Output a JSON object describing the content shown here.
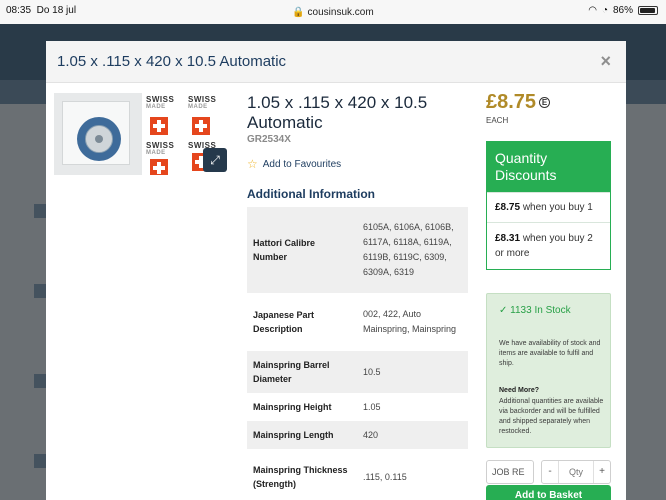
{
  "status_bar": {
    "time": "08:35",
    "date": "Do 18 jul",
    "url": "cousinsuk.com",
    "battery": "86%"
  },
  "modal": {
    "title": "1.05 x .115 x 420 x 10.5 Automatic",
    "close_label": "×"
  },
  "product": {
    "title": "1.05 x .115 x 420 x 10.5 Automatic",
    "sku": "GR2534X",
    "favourites_label": "Add to Favourites",
    "image_text": [
      "SWISS",
      "MADE"
    ]
  },
  "additional_information": {
    "heading": "Additional Information",
    "rows": [
      {
        "label": "Hattori Calibre Number",
        "value": "6105A, 6106A, 6106B, 6117A, 6118A, 6119A, 6119B, 6119C, 6309, 6309A, 6319"
      },
      {
        "label": "Japanese Part Description",
        "value": "002, 422, Auto Mainspring, Mainspring"
      },
      {
        "label": "Mainspring Barrel Diameter",
        "value": "10.5"
      },
      {
        "label": "Mainspring Height",
        "value": "1.05"
      },
      {
        "label": "Mainspring Length",
        "value": "420"
      },
      {
        "label": "Mainspring Thickness (Strength)",
        "value": ".115, 0.115"
      }
    ]
  },
  "pricing": {
    "price": "£8.75",
    "price_icon": "E",
    "unit": "EACH"
  },
  "quantity_discounts": {
    "heading": "Quantity Discounts",
    "tiers": [
      {
        "price": "£8.75",
        "text": "when you buy 1"
      },
      {
        "price": "£8.31",
        "text": "when you buy 2 or more"
      }
    ]
  },
  "stock": {
    "headline": "1133 In Stock",
    "text": "We have availability of stock and items are available to fulfil and ship.",
    "need_more": "Need More?",
    "more_text": "Additional quantities are available via backorder and will be fulfilled and shipped separately when restocked."
  },
  "purchase": {
    "job_ref_value": "JOB RE",
    "qty_placeholder": "Qty",
    "minus": "-",
    "plus": "+",
    "add_label": "Add to Basket"
  },
  "colors": {
    "accent_green": "#27ae53",
    "price_gold": "#b08a28",
    "navy": "#1d3c5f"
  }
}
